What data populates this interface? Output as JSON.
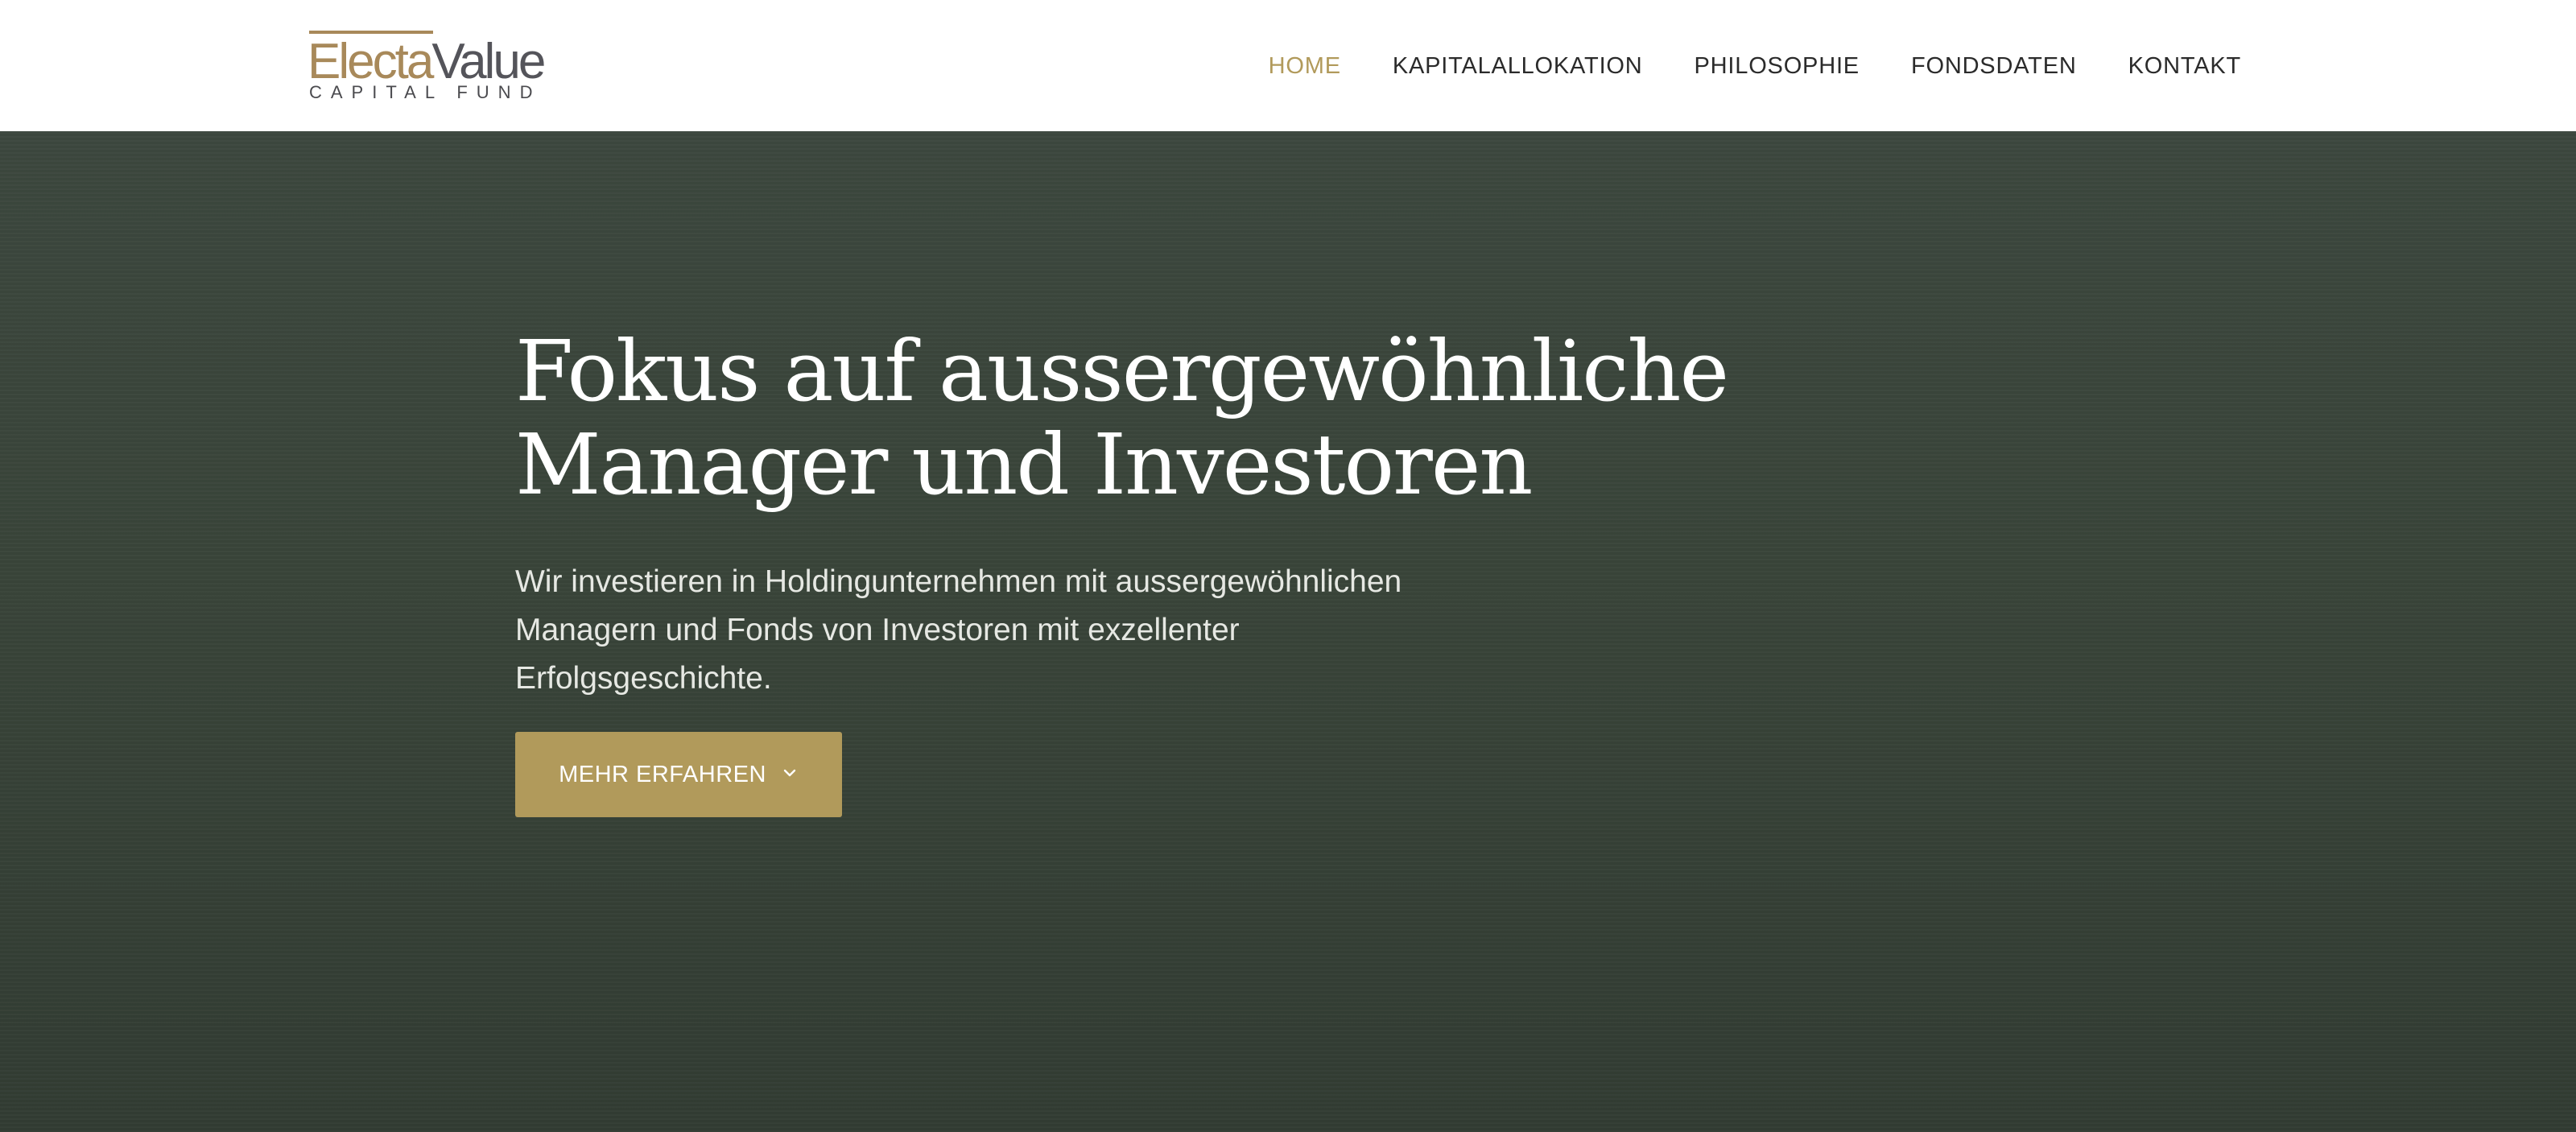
{
  "brand": {
    "logo_primary": "Electa",
    "logo_secondary": "Value",
    "logo_subtitle": "CAPITAL FUND",
    "accent_color": "#b19a5b",
    "logo_gray": "#54545a"
  },
  "nav": {
    "items": [
      {
        "label": "HOME",
        "active": true
      },
      {
        "label": "KAPITALALLOKATION",
        "active": false
      },
      {
        "label": "PHILOSOPHIE",
        "active": false
      },
      {
        "label": "FONDSDATEN",
        "active": false
      },
      {
        "label": "KONTAKT",
        "active": false
      }
    ]
  },
  "hero": {
    "title": "Fokus auf aussergewöhnliche Manager und Investoren",
    "text": "Wir investieren in Holdingunternehmen mit aussergewöhnlichen Managern und Fonds von Investoren mit exzellenter Erfolgsgeschichte.",
    "button_label": "MEHR ERFAHREN",
    "button_icon": "chevron-down-icon",
    "background_color": "#394439"
  }
}
